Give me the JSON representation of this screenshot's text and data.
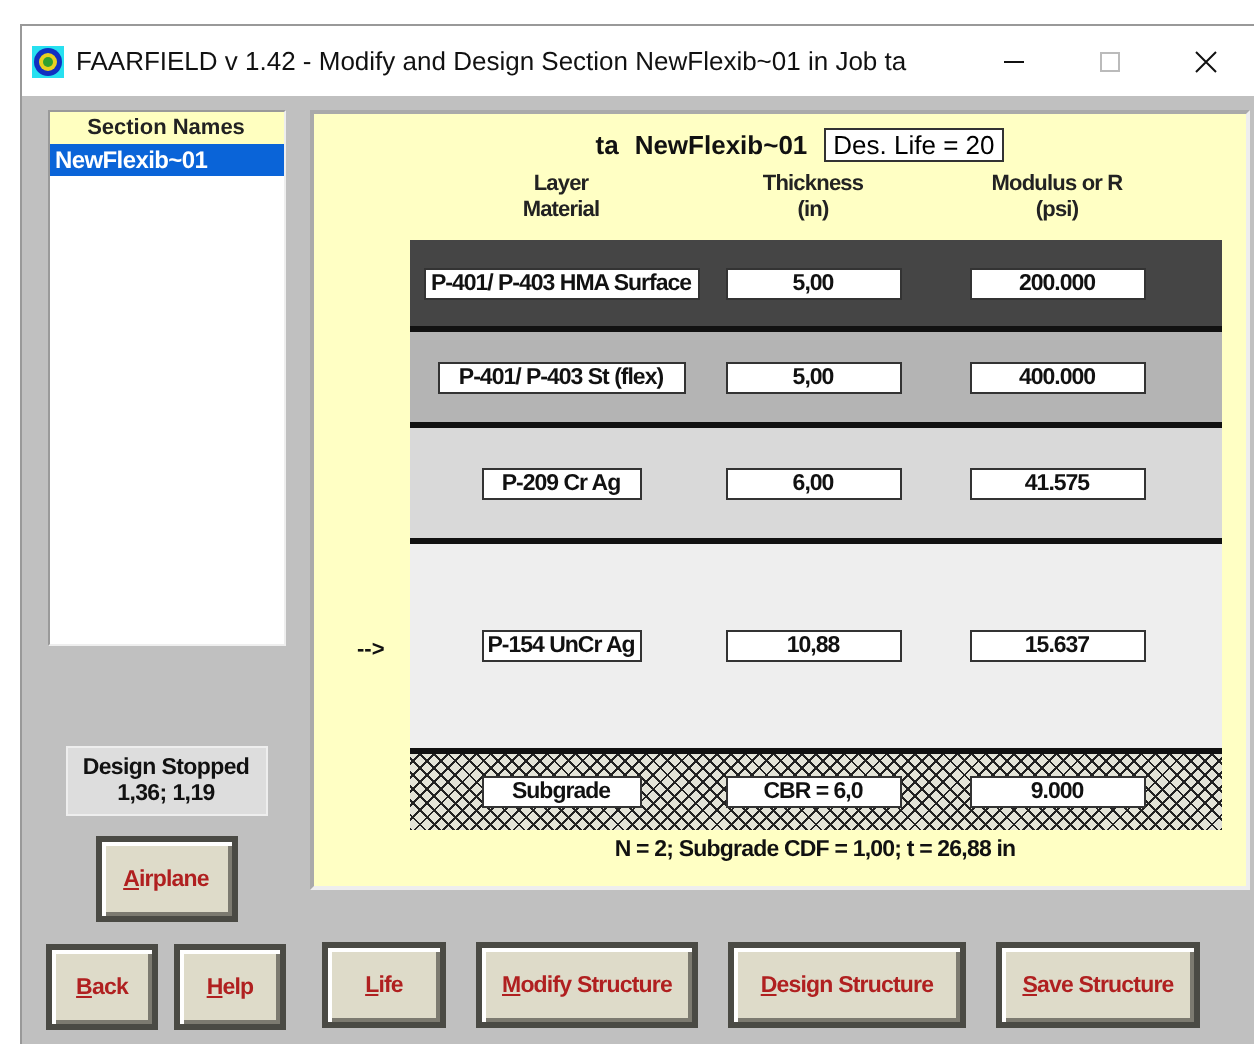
{
  "window": {
    "title": "FAARFIELD v 1.42 - Modify and Design Section NewFlexib~01 in Job ta"
  },
  "sections": {
    "header": "Section Names",
    "items": [
      {
        "label": "NewFlexib~01",
        "selected": true
      }
    ]
  },
  "status": {
    "line1": "Design Stopped",
    "line2": "1,36;  1,19"
  },
  "heading": {
    "job": "ta",
    "section": "NewFlexib~01",
    "design_life": "Des. Life = 20"
  },
  "columns": [
    {
      "line1": "Layer",
      "line2": "Material"
    },
    {
      "line1": "Thickness",
      "line2": "(in)"
    },
    {
      "line1": "Modulus or R",
      "line2": "(psi)"
    }
  ],
  "layers": [
    {
      "kind": "layer",
      "color": "#454545",
      "material": "P-401/ P-403 HMA Surface",
      "thickness": "5,00",
      "modulus": "200.000"
    },
    {
      "kind": "layer",
      "color": "#b4b4b4",
      "material": "P-401/ P-403 St (flex)",
      "thickness": "5,00",
      "modulus": "400.000"
    },
    {
      "kind": "layer",
      "color": "#d9d9d9",
      "material": "P-209 Cr Ag",
      "thickness": "6,00",
      "modulus": "41.575"
    },
    {
      "kind": "layer",
      "color": "#eeeeee",
      "marker": "-->",
      "material": "P-154 UnCr Ag",
      "thickness": "10,88",
      "modulus": "15.637"
    },
    {
      "kind": "subgrade",
      "color": "#e4e4d8",
      "material": "Subgrade",
      "thickness": "CBR = 6,0",
      "modulus": "9.000"
    }
  ],
  "summary": "N = 2;  Subgrade CDF = 1,00;  t = 26,88 in",
  "buttons": {
    "airplane": "Airplane",
    "back": "Back",
    "help": "Help",
    "bottom": [
      "Life",
      "Modify Structure",
      "Design Structure",
      "Save Structure"
    ]
  }
}
